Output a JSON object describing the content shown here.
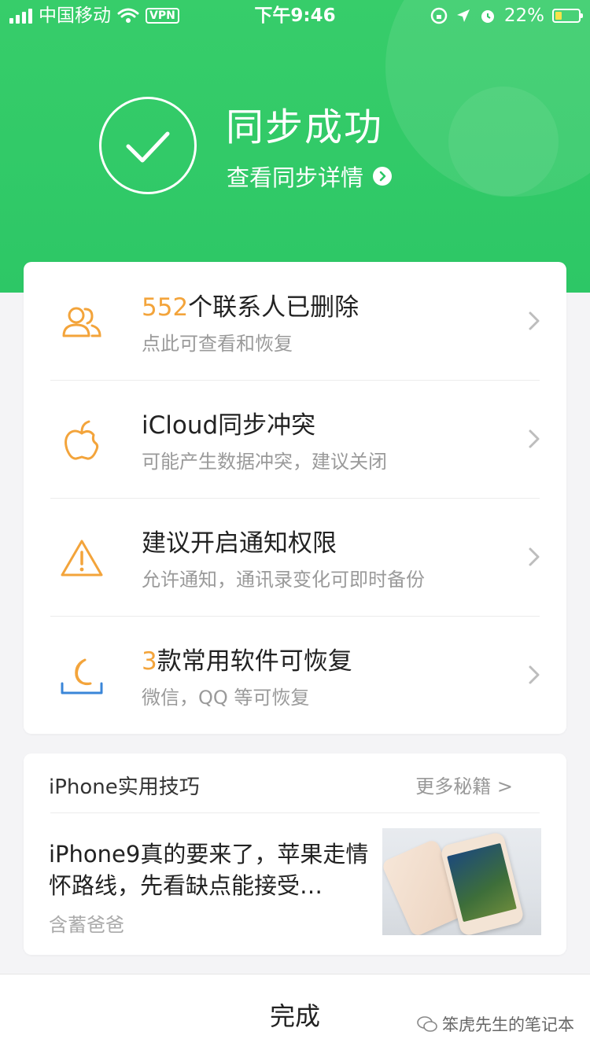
{
  "status_bar": {
    "carrier": "中国移动",
    "vpn": "VPN",
    "time": "下午9:46",
    "battery": "22%"
  },
  "hero": {
    "title": "同步成功",
    "link": "查看同步详情"
  },
  "items": [
    {
      "num": "552",
      "title": "个联系人已删除",
      "subtitle": "点此可查看和恢复",
      "icon": "contacts-icon"
    },
    {
      "num": "",
      "title": "iCloud同步冲突",
      "subtitle": "可能产生数据冲突，建议关闭",
      "icon": "apple-icon"
    },
    {
      "num": "",
      "title": "建议开启通知权限",
      "subtitle": "允许通知，通讯录变化可即时备份",
      "icon": "warning-icon"
    },
    {
      "num": "3",
      "title": "款常用软件可恢复",
      "subtitle": "微信，QQ 等可恢复",
      "icon": "restore-icon"
    }
  ],
  "tips": {
    "title": "iPhone实用技巧",
    "more": "更多秘籍 >",
    "article_title": "iPhone9真的要来了，苹果走情怀路线，先看缺点能接受…",
    "author": "含蓄爸爸"
  },
  "footer": {
    "done": "完成",
    "watermark": "笨虎先生的笔记本"
  },
  "colors": {
    "green": "#2dc766",
    "accent_orange": "#f3a43b",
    "icon_blue": "#3a86d8"
  }
}
